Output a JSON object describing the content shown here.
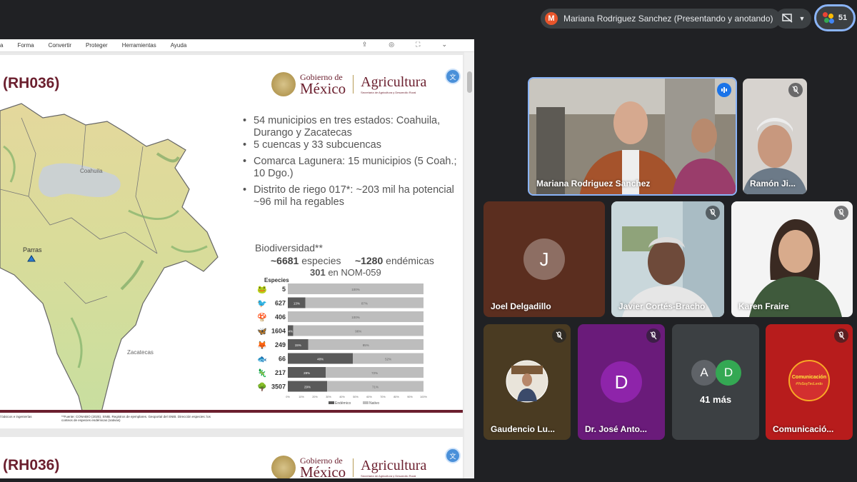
{
  "meeting": {
    "presenter_label": "Mariana Rodriguez Sanchez (Presentando y anotando)",
    "presenter_initial": "M",
    "people_count": "51"
  },
  "app_menu": [
    "a",
    "Forma",
    "Convertir",
    "Proteger",
    "Herramientas",
    "Ayuda"
  ],
  "slide": {
    "title": "(RH036)",
    "gov_line1": "Gobierno de",
    "gov_line2": "México",
    "agency": "Agricultura",
    "agency_sub": "Secretaría de Agricultura y Desarrollo Rural",
    "map_labels": {
      "north": "Coahuila",
      "south": "Zacatecas",
      "city": "Parras"
    },
    "bullets": [
      "54 municipios en tres estados: Coahuila, Durango y Zacatecas",
      "5 cuencas y 33 subcuencas",
      "Comarca Lagunera: 15 municipios (5 Coah.; 10 Dgo.)",
      "Distrito de riego 017*: ~203 mil ha potencial ~96 mil ha regables"
    ],
    "biodiversity_title": "Biodiversidad**",
    "species_count": "~6681",
    "species_label": "especies",
    "endemic_count": "~1280",
    "endemic_label": "endémicas",
    "nom_count": "301",
    "nom_label": "en NOM-059",
    "footer_left": "l básicos e ingenierías",
    "footer_note": "**Fuente: CONABIO (2025). SNIB. Registros de ejemplares. Geoportal del SNIB. Dirección especies: los conteos de especies endémicas (nativas)",
    "slide2_title": "(RH036)"
  },
  "chart_data": {
    "type": "bar",
    "orientation": "horizontal-stacked-100",
    "title": "Especies",
    "categories": [
      "5",
      "627",
      "406",
      "1604",
      "249",
      "66",
      "217",
      "3507"
    ],
    "icons": [
      "frog-icon",
      "bird-icon",
      "mushroom-icon",
      "butterfly-icon",
      "fox-icon",
      "fish-icon",
      "lizard-icon",
      "tree-icon"
    ],
    "series": [
      {
        "name": "Endémico",
        "values": [
          0,
          13,
          0,
          4,
          15,
          48,
          28,
          29
        ],
        "color": "#5a5a5a"
      },
      {
        "name": "Nativo",
        "values": [
          100,
          87,
          100,
          96,
          85,
          52,
          72,
          71
        ],
        "color": "#bdbdbd"
      }
    ],
    "xticks": [
      "0%",
      "10%",
      "20%",
      "30%",
      "40%",
      "50%",
      "60%",
      "70%",
      "80%",
      "90%",
      "100%"
    ],
    "xlim": [
      0,
      100
    ],
    "legend": "bottom"
  },
  "participants": [
    {
      "name": "Mariana Rodriguez Sanchez",
      "type": "video",
      "speaking": true
    },
    {
      "name": "Ramón Ji...",
      "type": "video",
      "muted": true
    },
    {
      "name": "Joel Delgadillo",
      "type": "avatar",
      "initial": "J",
      "bg": "#5b2e1f",
      "avatar_bg": "#8d6e63"
    },
    {
      "name": "Javier Cortés-Bracho",
      "type": "video",
      "muted": true
    },
    {
      "name": "Karen Fraire",
      "type": "video",
      "muted": true
    },
    {
      "name": "Gaudencio Lu...",
      "type": "photo",
      "muted": true,
      "bg": "#4a3b22"
    },
    {
      "name": "Dr. José Anto...",
      "type": "avatar",
      "initial": "D",
      "bg": "#6a1b7a",
      "avatar_bg": "#8e24aa",
      "muted": true
    },
    {
      "name": "41 más",
      "type": "more",
      "initials": [
        "A",
        "D"
      ]
    },
    {
      "name": "Comunicació...",
      "type": "logo",
      "muted": true,
      "bg": "#b71c1c",
      "logo_text": "Comunicación",
      "logo_tag": "#YoSoyTecLerdo"
    }
  ]
}
